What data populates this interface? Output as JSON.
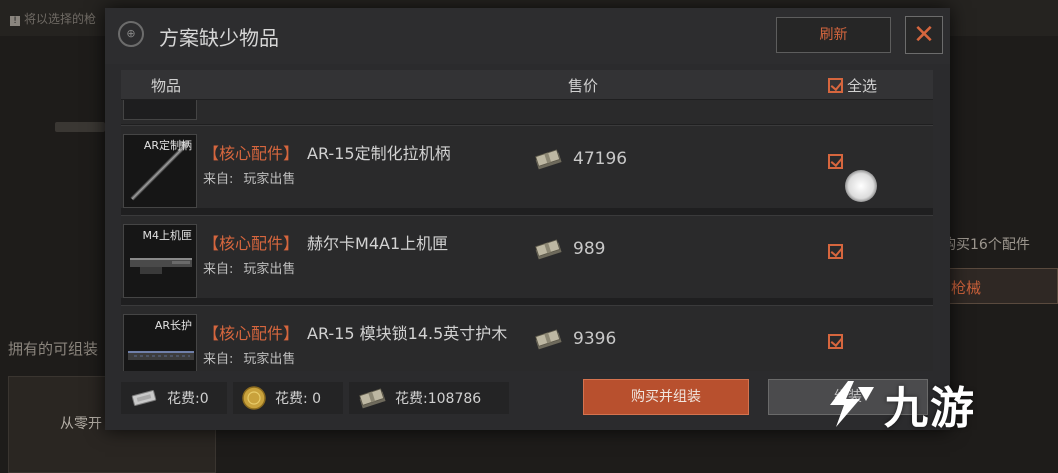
{
  "background": {
    "notice": "将以选择的枪",
    "owned_label": "拥有的可组装",
    "left_button": "从零开",
    "right_text": "购买16个配件",
    "right_button": "枪械"
  },
  "dialog": {
    "title": "方案缺少物品",
    "refresh_label": "刷新",
    "columns": {
      "item": "物品",
      "price": "售价",
      "select_all": "全选"
    },
    "rows": [
      {
        "thumb_label": "AR定制柄",
        "tag": "【核心配件】",
        "name": "AR-15定制化拉机柄",
        "source_label": "来自:",
        "source": "玩家出售",
        "price": "47196",
        "checked": true
      },
      {
        "thumb_label": "M4上机匣",
        "tag": "【核心配件】",
        "name": "赫尔卡M4A1上机匣",
        "source_label": "来自:",
        "source": "玩家出售",
        "price": "989",
        "checked": true
      },
      {
        "thumb_label": "AR长护",
        "tag": "【核心配件】",
        "name": "AR-15 模块锁14.5英寸护木",
        "source_label": "来自:",
        "source": "玩家出售",
        "price": "9396",
        "checked": true
      }
    ],
    "costs": [
      {
        "label": "花费:0",
        "icon": "silver-bar-icon"
      },
      {
        "label": "花费: 0",
        "icon": "gold-coin-icon"
      },
      {
        "label": "花费:108786",
        "icon": "cash-stack-icon"
      }
    ],
    "buy_label": "购买并组装",
    "second_label": "组装"
  },
  "watermark": {
    "text": "九游"
  },
  "colors": {
    "accent": "#d6663e",
    "buy_button": "#b8502e",
    "panel": "#2b2b2d"
  }
}
